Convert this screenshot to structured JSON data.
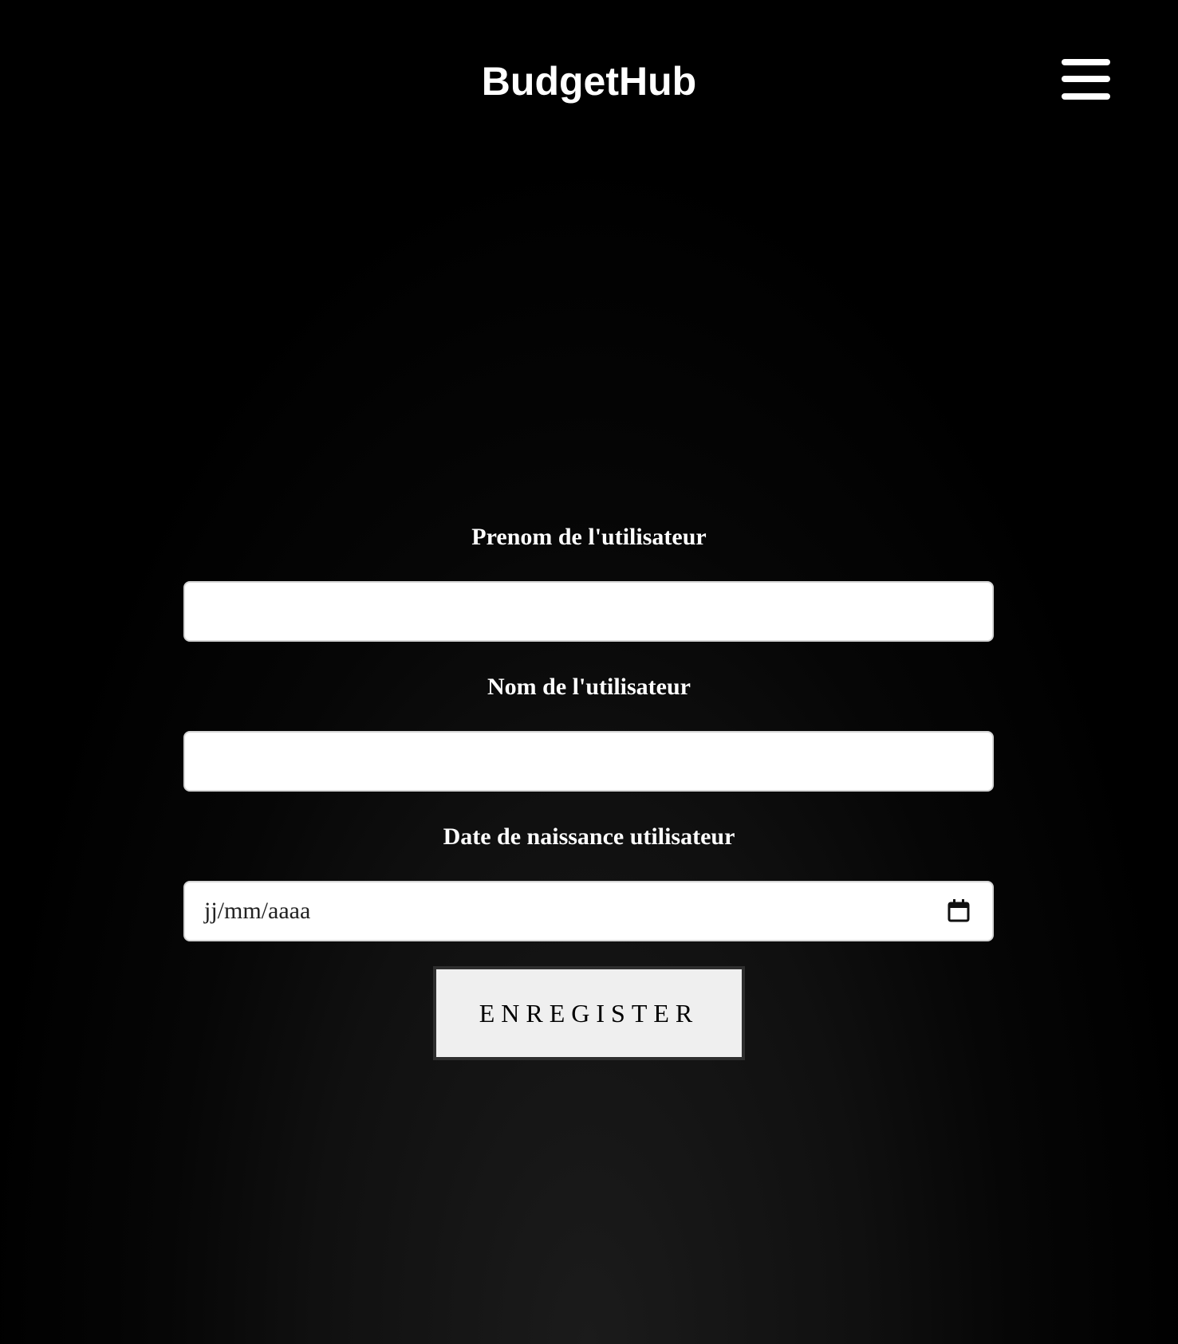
{
  "header": {
    "brand": "BudgetHub",
    "menu_icon": "hamburger-menu-icon"
  },
  "form": {
    "first_name": {
      "label": "Prenom de l'utilisateur",
      "value": ""
    },
    "last_name": {
      "label": "Nom de l'utilisateur",
      "value": ""
    },
    "birth_date": {
      "label": "Date de naissance utilisateur",
      "placeholder": "jj/mm/aaaa",
      "icon": "calendar-icon"
    },
    "submit_label": "ENREGISTER"
  },
  "colors": {
    "background": "#000000",
    "text": "#ffffff",
    "field_background": "#ffffff",
    "button_background": "#efefef",
    "button_border": "#2e2e2e"
  }
}
